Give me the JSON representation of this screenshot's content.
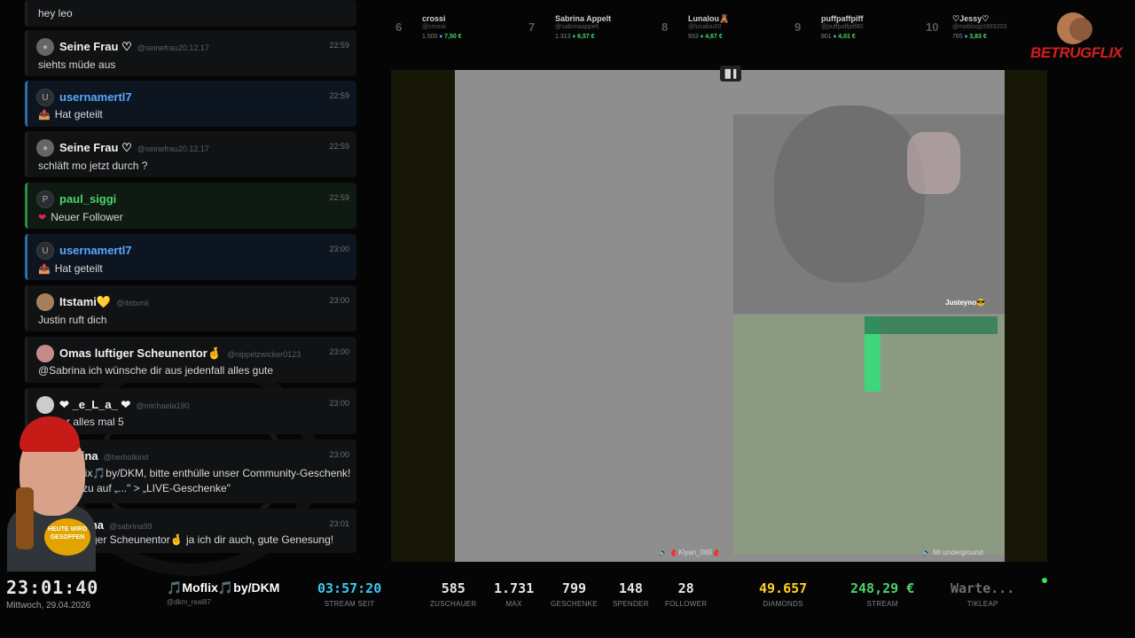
{
  "chat": {
    "messages": [
      {
        "user": "",
        "handle": "",
        "time": "",
        "text": "hey leo",
        "type": "normal"
      },
      {
        "user": "Seine Frau ♡",
        "handle": "@seinefrau20.12.17",
        "time": "22:59",
        "text": "siehts müde aus",
        "type": "normal"
      },
      {
        "user": "usernamertl7",
        "handle": "",
        "time": "22:59",
        "text": "Hat geteilt",
        "type": "share",
        "avatar_letter": "U"
      },
      {
        "user": "Seine Frau ♡",
        "handle": "@seinefrau20.12.17",
        "time": "22:59",
        "text": "schläft mo jetzt durch ?",
        "type": "normal"
      },
      {
        "user": "paul_siggi",
        "handle": "",
        "time": "22:59",
        "text": "Neuer Follower",
        "type": "follow",
        "avatar_letter": "P"
      },
      {
        "user": "usernamertl7",
        "handle": "",
        "time": "23:00",
        "text": "Hat geteilt",
        "type": "share",
        "avatar_letter": "U"
      },
      {
        "user": "Itstami💛",
        "handle": "@itstxmii",
        "time": "23:00",
        "text": "Justin ruft dich",
        "type": "normal"
      },
      {
        "user": "Omas luftiger Scheunentor🤞",
        "handle": "@nippelzwicker0123",
        "time": "23:00",
        "text": "@Sabrina ich wünsche dir aus jedenfall alles gute",
        "type": "normal"
      },
      {
        "user": "❤ _e_L_a_ ❤",
        "handle": "@michaela190",
        "time": "23:00",
        "text": "D... ter alles mal 5",
        "type": "normal"
      },
      {
        "user": "...ina",
        "handle": "@herbstkind",
        "time": "23:00",
        "text": "...lix🎵by/DKM, bitte enthülle unser Community-Geschenk!",
        "text2": "...zu auf „...\" > „LIVE-Geschenke\"",
        "type": "normal"
      },
      {
        "user": "...na",
        "handle": "@sabrina99",
        "time": "23:01",
        "text": "...ger Scheunentor🤞 ja ich dir auch, gute Genesung!",
        "type": "normal"
      }
    ],
    "share_icon": "share-icon",
    "follow_icon": "heart-icon"
  },
  "leaderboard": [
    {
      "rank": "6",
      "name": "crossi",
      "handle": "@crossii",
      "diamonds": "1.500",
      "euro": "7,50 €"
    },
    {
      "rank": "7",
      "name": "Sabrina Appelt",
      "handle": "@sabrinaappelt",
      "diamonds": "1.313",
      "euro": "6,57 €"
    },
    {
      "rank": "8",
      "name": "Lunalou🧸",
      "handle": "@lunalou00",
      "diamonds": "933",
      "euro": "4,67 €"
    },
    {
      "rank": "9",
      "name": "puffpaffpiff",
      "handle": "@puffpaffpiff80",
      "diamonds": "801",
      "euro": "4,01 €"
    },
    {
      "rank": "10",
      "name": "♡Jessy♡",
      "handle": "@mobloop1993203",
      "diamonds": "765",
      "euro": "3,83 €"
    }
  ],
  "logo": {
    "text": "BETRUGFLIX"
  },
  "streamer": {
    "label": "HEUTE WIRD GESOFFEN"
  },
  "video": {
    "cam_tag": "Justeyno😎",
    "speaker_left": "🔈 🩸Kiyan_069🩸",
    "speaker_right": "🔈 Mr.underground",
    "top_control": "▐▌▌"
  },
  "bottom": {
    "clock": "23:01:40",
    "date": "Mittwoch, 29.04.2026",
    "channel": "🎵Moflix🎵by/DKM",
    "channel_handle": "@dkm_real87",
    "stats": [
      {
        "value": "03:57:20",
        "label": "STREAM SEIT"
      },
      {
        "value": "585",
        "label": "ZUSCHAUER"
      },
      {
        "value": "1.731",
        "label": "MAX"
      },
      {
        "value": "799",
        "label": "GESCHENKE"
      },
      {
        "value": "148",
        "label": "SPENDER"
      },
      {
        "value": "28",
        "label": "FOLLOWER"
      },
      {
        "value": "49.657",
        "label": "DIAMONDS"
      },
      {
        "value": "248,29 €",
        "label": "STREAM"
      },
      {
        "value": "Warte...",
        "label": "TIKLEAP"
      }
    ]
  }
}
